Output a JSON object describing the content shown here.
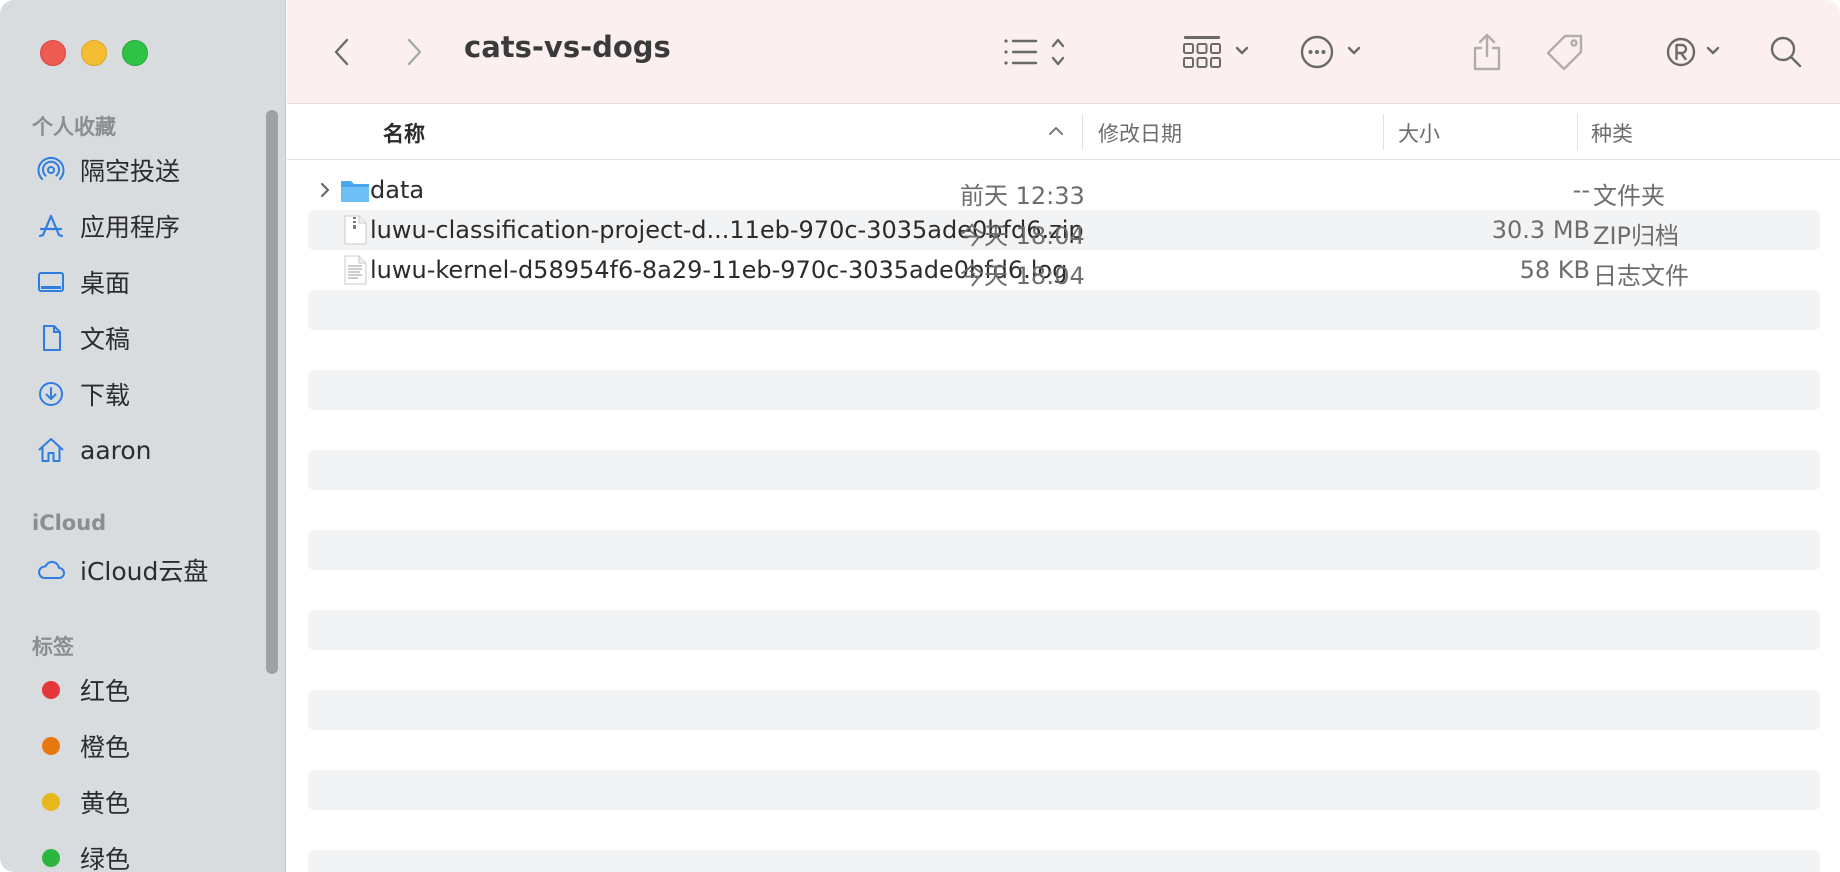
{
  "window": {
    "folder_title": "cats-vs-dogs"
  },
  "sidebar": {
    "favorites_header": "个人收藏",
    "favorites": [
      {
        "label": "隔空投送",
        "icon": "airdrop-icon"
      },
      {
        "label": "应用程序",
        "icon": "applications-icon"
      },
      {
        "label": "桌面",
        "icon": "desktop-icon"
      },
      {
        "label": "文稿",
        "icon": "document-icon"
      },
      {
        "label": "下载",
        "icon": "download-icon"
      },
      {
        "label": "aaron",
        "icon": "home-icon"
      }
    ],
    "icloud_header": "iCloud",
    "icloud_items": [
      {
        "label": "iCloud云盘",
        "icon": "cloud-icon"
      }
    ],
    "tags_header": "标签",
    "tags": [
      {
        "label": "红色",
        "color": "#e5383b"
      },
      {
        "label": "橙色",
        "color": "#e8790f"
      },
      {
        "label": "黄色",
        "color": "#e6b81c"
      },
      {
        "label": "绿色",
        "color": "#2bb541"
      }
    ]
  },
  "toolbar": {
    "back_icon": "chevron-left-icon",
    "forward_icon": "chevron-right-icon",
    "view_icon": "list-view-icon",
    "group_icon": "grid-group-icon",
    "action_icon": "more-icon",
    "share_icon": "share-icon",
    "tag_icon": "tag-icon",
    "extension_icon": "registered-icon",
    "search_icon": "search-icon"
  },
  "columns": {
    "name": "名称",
    "date": "修改日期",
    "size": "大小",
    "kind": "种类"
  },
  "files": [
    {
      "name": "data",
      "date": "前天 12:33",
      "size": "--",
      "kind": "文件夹",
      "type": "folder"
    },
    {
      "name": "luwu-classification-project-d...11eb-970c-3035ade0bfd6.zip",
      "date": "今天 18:04",
      "size": "30.3 MB",
      "kind": "ZIP归档",
      "type": "zip"
    },
    {
      "name": "luwu-kernel-d58954f6-8a29-11eb-970c-3035ade0bfd6.log",
      "date": "今天 18:04",
      "size": "58 KB",
      "kind": "日志文件",
      "type": "log"
    }
  ]
}
